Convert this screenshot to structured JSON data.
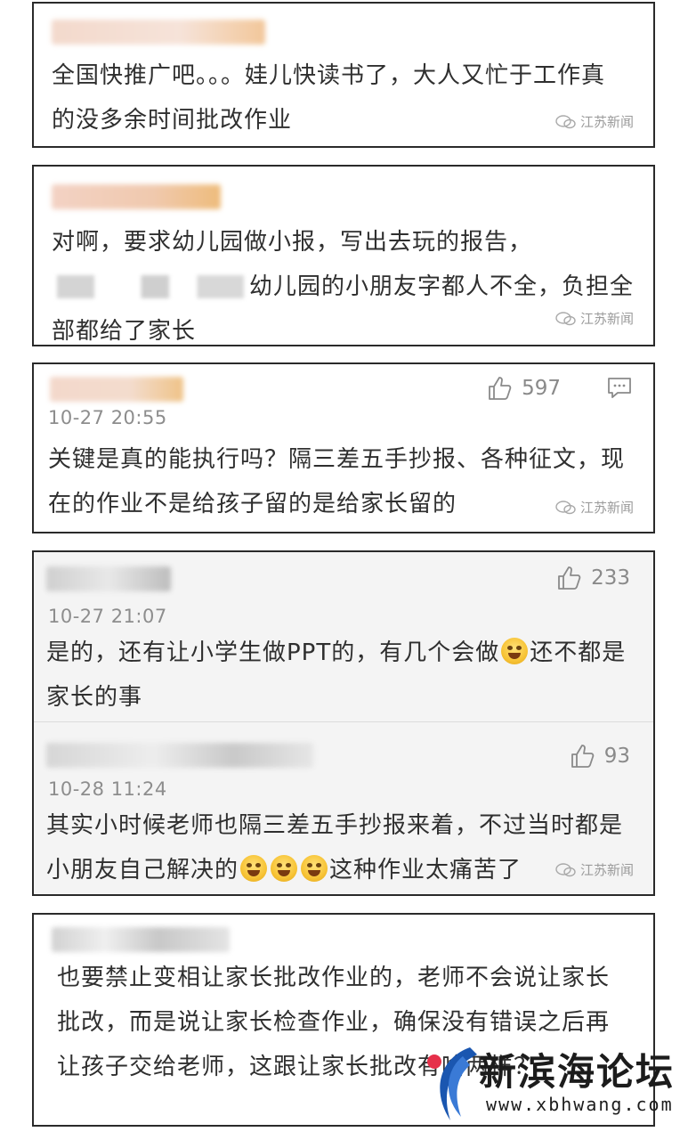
{
  "watermark_text": "江苏新闻",
  "comments": [
    {
      "text": "全国快推广吧。。。娃儿快读书了，大人又忙于工作真的没多余时间批改作业"
    },
    {
      "text_a": "对啊，要求幼儿园做小报，写出去玩的报告，",
      "text_b": "幼儿园的小朋友字都人不全，负担全部都给了家长"
    },
    {
      "time": "10-27 20:55",
      "likes": "597",
      "text": "关键是真的能执行吗？隔三差五手抄报、各种征文，现在的作业不是给孩子留的是给家长留的"
    },
    {
      "time": "10-27 21:07",
      "likes": "233",
      "text_a": "是的，还有让小学生做PPT的，有几个会做",
      "text_b": "还不都是家长的事"
    },
    {
      "time": "10-28 11:24",
      "likes": "93",
      "text_a": "其实小时候老师也隔三差五手抄报来着，不过当时都是小朋友自己解决的",
      "text_b": "这种作业太痛苦了"
    },
    {
      "text": "也要禁止变相让家长批改作业的，老师不会说让家长批改，而是说让家长检查作业，确保没有错误之后再让孩子交给老师，这跟让家长批改有啥两样？"
    }
  ],
  "logo": {
    "name": "新滨海论坛",
    "url": "www.xbhwang.com"
  },
  "colors": {
    "border": "#2a2a2a",
    "meta": "#8d8d8d",
    "logo_blue": "#1a56b0",
    "logo_red": "#e6304a"
  }
}
